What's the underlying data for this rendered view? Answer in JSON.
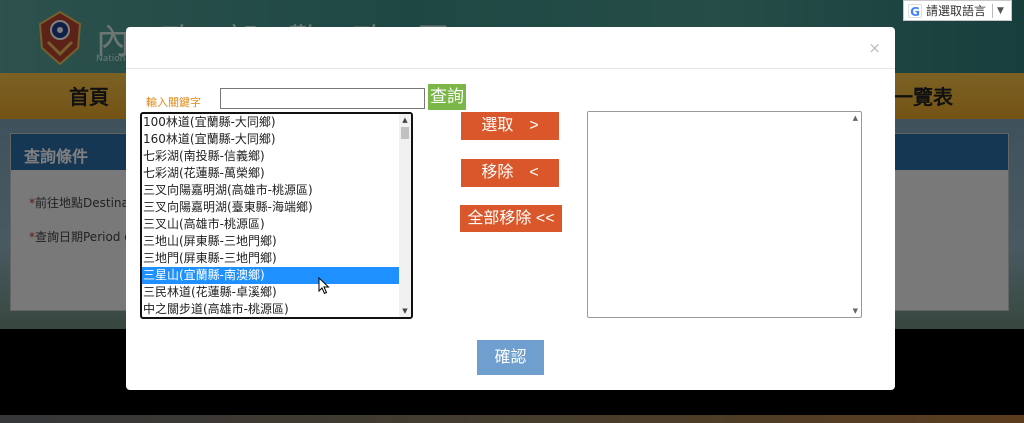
{
  "background": {
    "site_title": "內政部警政署",
    "site_subtitle": "National",
    "nav": {
      "home": "首頁",
      "list": "一覽表"
    },
    "panel_title": "查詢條件",
    "field_destination": "前往地點Destinat",
    "field_period": "查詢日期Period o",
    "required_mark": "*"
  },
  "language_widget": {
    "label": "請選取語言",
    "arrow": "▼",
    "logo": "G"
  },
  "modal": {
    "close_label": "×",
    "keyword_label": "輸入關鍵字",
    "keyword_value": "",
    "search_label": "查詢",
    "options": [
      "100林道(宜蘭縣-大同鄉)",
      "160林道(宜蘭縣-大同鄉)",
      "七彩湖(南投縣-信義鄉)",
      "七彩湖(花蓮縣-萬榮鄉)",
      "三叉向陽嘉明湖(高雄市-桃源區)",
      "三叉向陽嘉明湖(臺東縣-海端鄉)",
      "三叉山(高雄市-桃源區)",
      "三地山(屏東縣-三地門鄉)",
      "三地門(屏東縣-三地門鄉)",
      "三星山(宜蘭縣-南澳鄉)",
      "三民林道(花蓮縣-卓溪鄉)",
      "中之關步道(高雄市-桃源區)"
    ],
    "selected_index": 9,
    "select_label": "選取　>",
    "remove_label": "移除　<",
    "remove_all_label": "全部移除 <<",
    "confirm_label": "確認"
  }
}
